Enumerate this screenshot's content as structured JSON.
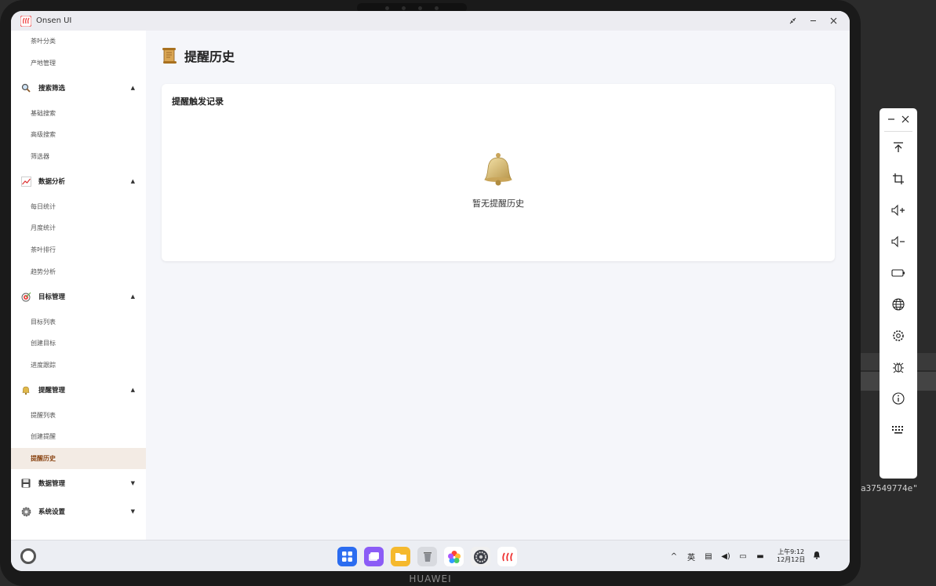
{
  "window": {
    "title": "Onsen UI",
    "logo_text": "Onsen UI"
  },
  "sidebar": {
    "items": [
      {
        "type": "sub",
        "label": "茶叶分类"
      },
      {
        "type": "sub",
        "label": "产地管理"
      },
      {
        "type": "group",
        "label": "搜索筛选",
        "icon": "magnifier-icon",
        "expanded": true
      },
      {
        "type": "sub",
        "label": "基础搜索"
      },
      {
        "type": "sub",
        "label": "高级搜索"
      },
      {
        "type": "sub",
        "label": "筛选器"
      },
      {
        "type": "group",
        "label": "数据分析",
        "icon": "chart-icon",
        "expanded": true
      },
      {
        "type": "sub",
        "label": "每日统计"
      },
      {
        "type": "sub",
        "label": "月度统计"
      },
      {
        "type": "sub",
        "label": "茶叶排行"
      },
      {
        "type": "sub",
        "label": "趋势分析"
      },
      {
        "type": "group",
        "label": "目标管理",
        "icon": "target-icon",
        "expanded": true
      },
      {
        "type": "sub",
        "label": "目标列表"
      },
      {
        "type": "sub",
        "label": "创建目标"
      },
      {
        "type": "sub",
        "label": "进度跟踪"
      },
      {
        "type": "group",
        "label": "提醒管理",
        "icon": "bell-icon",
        "expanded": true
      },
      {
        "type": "sub",
        "label": "提醒列表"
      },
      {
        "type": "sub",
        "label": "创建提醒"
      },
      {
        "type": "sub",
        "label": "提醒历史",
        "active": true
      },
      {
        "type": "group",
        "label": "数据管理",
        "icon": "floppy-icon",
        "expanded": false
      },
      {
        "type": "group",
        "label": "系统设置",
        "icon": "gear-icon",
        "expanded": false
      }
    ]
  },
  "main": {
    "page_title": "提醒历史",
    "page_icon": "scroll-icon",
    "card_title": "提醒触发记录",
    "empty_text": "暂无提醒历史"
  },
  "taskbar": {
    "dock": [
      "app-center-icon",
      "multitask-icon",
      "files-icon",
      "trash-icon",
      "gallery-icon",
      "settings-icon",
      "onsen-app-icon"
    ],
    "tray": {
      "ime_label": "英",
      "time": "上午9:12",
      "date": "12月12日"
    }
  },
  "background": {
    "terminal_text": "a37549774e\""
  },
  "colors": {
    "accent": "#8b4513",
    "active_bg": "#f3ebe4",
    "bell_gold": "#d9b86a"
  }
}
